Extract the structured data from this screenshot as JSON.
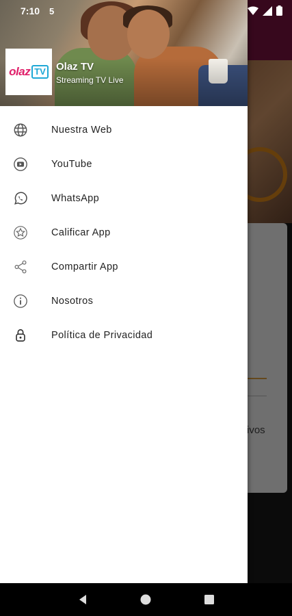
{
  "status_bar": {
    "time": "7:10",
    "sim_indicator": "5",
    "icons": [
      "wifi-icon",
      "signal-icon",
      "battery-icon"
    ]
  },
  "background": {
    "card_text": "ivos",
    "toolbar_color": "#7a1340",
    "accent_color": "#e08a1a"
  },
  "drawer": {
    "header": {
      "logo_text": "olaz",
      "logo_badge": "TV",
      "title": "Olaz TV",
      "subtitle": "Streaming TV Live"
    },
    "items": [
      {
        "label": "Nuestra Web",
        "icon": "globe-icon"
      },
      {
        "label": "YouTube",
        "icon": "youtube-icon"
      },
      {
        "label": "WhatsApp",
        "icon": "whatsapp-icon"
      },
      {
        "label": "Calificar App",
        "icon": "star-icon"
      },
      {
        "label": "Compartir App",
        "icon": "share-icon"
      },
      {
        "label": "Nosotros",
        "icon": "info-icon"
      },
      {
        "label": "Política de Privacidad",
        "icon": "lock-icon"
      }
    ]
  },
  "nav_bar": {
    "buttons": [
      "back-icon",
      "home-icon",
      "recents-icon"
    ]
  },
  "colors": {
    "logo_pink": "#e0206a",
    "logo_blue": "#1fa8d6",
    "icon_gray": "#555555"
  }
}
